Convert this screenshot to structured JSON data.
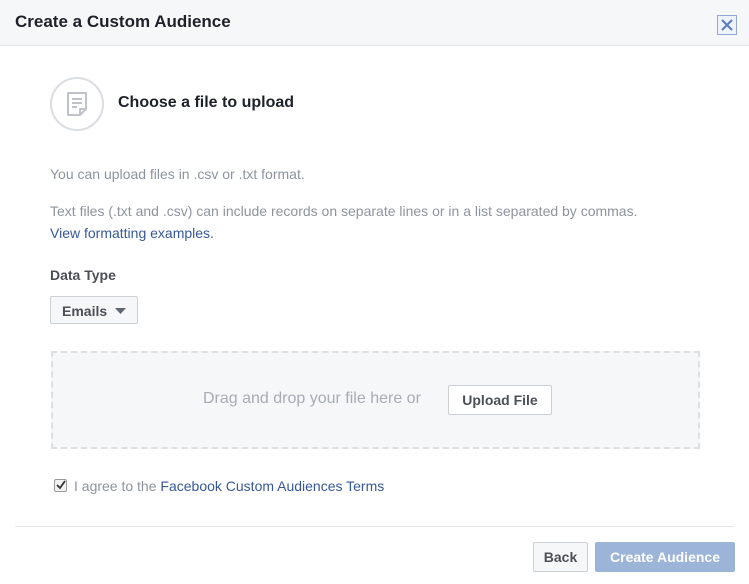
{
  "dialog": {
    "title": "Create a Custom Audience",
    "close_icon": "close-icon"
  },
  "upload": {
    "file_icon": "document-icon",
    "heading": "Choose a file to upload",
    "format_text": "You can upload files in .csv or .txt format.",
    "records_text": "Text files (.txt and .csv) can include records on separate lines or in a list separated by commas.",
    "formatting_link": "View formatting examples."
  },
  "data_type": {
    "label": "Data Type",
    "selected": "Emails",
    "caret_icon": "caret-down-icon"
  },
  "dropzone": {
    "text": "Drag and drop your file here or",
    "upload_button": "Upload File"
  },
  "terms": {
    "checked": true,
    "prefix": "I agree to the",
    "link": "Facebook Custom Audiences Terms"
  },
  "footer": {
    "back_button": "Back",
    "create_button": "Create Audience"
  },
  "colors": {
    "link": "#365899",
    "primary_disabled": "#9cb4d8",
    "header_bg": "#f6f7f9"
  }
}
